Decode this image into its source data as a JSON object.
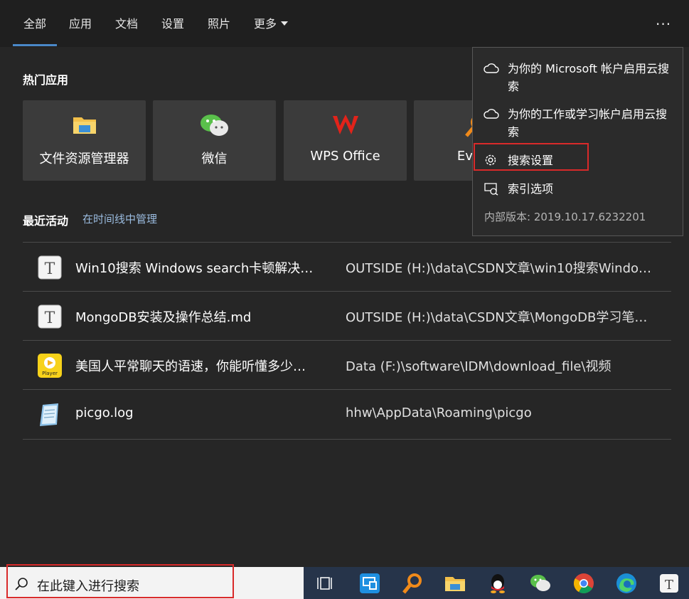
{
  "tabs": [
    {
      "label": "全部"
    },
    {
      "label": "应用"
    },
    {
      "label": "文档"
    },
    {
      "label": "设置"
    },
    {
      "label": "照片"
    },
    {
      "label": "更多"
    }
  ],
  "more_icon": "ellipsis-icon",
  "top_apps": {
    "title": "热门应用",
    "tiles": [
      {
        "label": "文件资源管理器",
        "icon": "folder-icon"
      },
      {
        "label": "微信",
        "icon": "wechat-icon"
      },
      {
        "label": "WPS Office",
        "icon": "wps-icon"
      },
      {
        "label": "Every",
        "icon": "everything-search-icon"
      }
    ]
  },
  "recent": {
    "title": "最近活动",
    "manage_link": "在时间线中管理",
    "items": [
      {
        "name": "Win10搜索 Windows search卡顿解决…",
        "path": "OUTSIDE (H:)\\data\\CSDN文章\\win10搜索Windo…",
        "icon": "text-file-icon"
      },
      {
        "name": "MongoDB安装及操作总结.md",
        "path": "OUTSIDE (H:)\\data\\CSDN文章\\MongoDB学习笔…",
        "icon": "text-file-icon"
      },
      {
        "name": "美国人平常聊天的语速，你能听懂多少…",
        "path": "Data (F:)\\software\\IDM\\download_file\\视频",
        "icon": "video-player-icon"
      },
      {
        "name": "picgo.log",
        "path": "hhw\\AppData\\Roaming\\picgo",
        "icon": "notepad-icon"
      }
    ]
  },
  "menu": {
    "items": [
      {
        "label": "为你的 Microsoft 帐户启用云搜索",
        "icon": "cloud-icon"
      },
      {
        "label": "为你的工作或学习帐户启用云搜索",
        "icon": "cloud-icon"
      },
      {
        "label": "搜索设置",
        "icon": "gear-icon"
      },
      {
        "label": "索引选项",
        "icon": "indexing-options-icon"
      }
    ],
    "version": "内部版本: 2019.10.17.6232201"
  },
  "search": {
    "placeholder": "在此键入进行搜索",
    "icon": "search-icon"
  },
  "taskbar": {
    "icons": [
      "task-view-icon",
      "remote-desktop-icon",
      "everything-icon",
      "file-explorer-icon",
      "qq-icon",
      "wechat-icon",
      "chrome-icon",
      "edge-icon",
      "typora-icon"
    ]
  },
  "colors": {
    "accent": "#4a88c8",
    "highlight_box": "#d92a2a",
    "taskbar": "#26344a"
  }
}
